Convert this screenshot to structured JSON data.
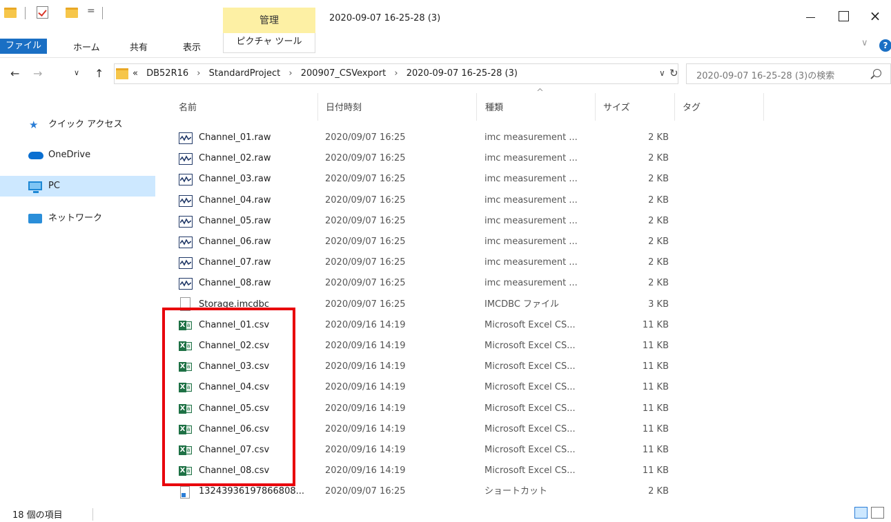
{
  "window": {
    "title": "2020-09-07 16-25-28 (3)",
    "manage_tab": "管理"
  },
  "quick_access_toolbar": {
    "dropdown": "="
  },
  "window_controls": {
    "close": "×"
  },
  "ribbon": {
    "tabs": [
      "ファイル",
      "ホーム",
      "共有",
      "表示",
      "ピクチャ ツール"
    ],
    "expand": "∨",
    "help": "?"
  },
  "navigation": {
    "back": "←",
    "forward": "→",
    "recent": "∨",
    "up": "↑",
    "overflow": "«",
    "breadcrumbs": [
      "DB52R16",
      "StandardProject",
      "200907_CSVexport",
      "2020-09-07 16-25-28 (3)"
    ],
    "separator": "›",
    "dropdown": "∨",
    "refresh": "↻"
  },
  "search": {
    "placeholder": "2020-09-07 16-25-28 (3)の検索"
  },
  "sidebar": {
    "items": [
      {
        "label": "クイック アクセス",
        "icon": "star-icon"
      },
      {
        "label": "OneDrive",
        "icon": "cloud-icon"
      },
      {
        "label": "PC",
        "icon": "computer-icon"
      },
      {
        "label": "ネットワーク",
        "icon": "network-icon"
      }
    ]
  },
  "columns": {
    "name": "名前",
    "date": "日付時刻",
    "type": "種類",
    "size": "サイズ",
    "tag": "タグ",
    "sort_indicator": "^"
  },
  "files": [
    {
      "name": "Channel_01.raw",
      "date": "2020/09/07 16:25",
      "type": "imc measurement ...",
      "size": "2 KB",
      "icon": "raw"
    },
    {
      "name": "Channel_02.raw",
      "date": "2020/09/07 16:25",
      "type": "imc measurement ...",
      "size": "2 KB",
      "icon": "raw"
    },
    {
      "name": "Channel_03.raw",
      "date": "2020/09/07 16:25",
      "type": "imc measurement ...",
      "size": "2 KB",
      "icon": "raw"
    },
    {
      "name": "Channel_04.raw",
      "date": "2020/09/07 16:25",
      "type": "imc measurement ...",
      "size": "2 KB",
      "icon": "raw"
    },
    {
      "name": "Channel_05.raw",
      "date": "2020/09/07 16:25",
      "type": "imc measurement ...",
      "size": "2 KB",
      "icon": "raw"
    },
    {
      "name": "Channel_06.raw",
      "date": "2020/09/07 16:25",
      "type": "imc measurement ...",
      "size": "2 KB",
      "icon": "raw"
    },
    {
      "name": "Channel_07.raw",
      "date": "2020/09/07 16:25",
      "type": "imc measurement ...",
      "size": "2 KB",
      "icon": "raw"
    },
    {
      "name": "Channel_08.raw",
      "date": "2020/09/07 16:25",
      "type": "imc measurement ...",
      "size": "2 KB",
      "icon": "raw"
    },
    {
      "name": "Storage.imcdbc",
      "date": "2020/09/07 16:25",
      "type": "IMCDBC ファイル",
      "size": "3 KB",
      "icon": "doc"
    },
    {
      "name": "Channel_01.csv",
      "date": "2020/09/16 14:19",
      "type": "Microsoft Excel CS...",
      "size": "11 KB",
      "icon": "xls"
    },
    {
      "name": "Channel_02.csv",
      "date": "2020/09/16 14:19",
      "type": "Microsoft Excel CS...",
      "size": "11 KB",
      "icon": "xls"
    },
    {
      "name": "Channel_03.csv",
      "date": "2020/09/16 14:19",
      "type": "Microsoft Excel CS...",
      "size": "11 KB",
      "icon": "xls"
    },
    {
      "name": "Channel_04.csv",
      "date": "2020/09/16 14:19",
      "type": "Microsoft Excel CS...",
      "size": "11 KB",
      "icon": "xls"
    },
    {
      "name": "Channel_05.csv",
      "date": "2020/09/16 14:19",
      "type": "Microsoft Excel CS...",
      "size": "11 KB",
      "icon": "xls"
    },
    {
      "name": "Channel_06.csv",
      "date": "2020/09/16 14:19",
      "type": "Microsoft Excel CS...",
      "size": "11 KB",
      "icon": "xls"
    },
    {
      "name": "Channel_07.csv",
      "date": "2020/09/16 14:19",
      "type": "Microsoft Excel CS...",
      "size": "11 KB",
      "icon": "xls"
    },
    {
      "name": "Channel_08.csv",
      "date": "2020/09/16 14:19",
      "type": "Microsoft Excel CS...",
      "size": "11 KB",
      "icon": "xls"
    },
    {
      "name": "13243936197866808...",
      "date": "2020/09/07 16:25",
      "type": "ショートカット",
      "size": "2 KB",
      "icon": "lnk"
    }
  ],
  "status_bar": {
    "item_count": "18 個の項目"
  },
  "colors": {
    "accent": "#1a6fc4",
    "manage_tab": "#fdf0a4",
    "selection": "#cde8ff",
    "highlight_box": "#e8000b",
    "excel_green": "#1e7145"
  }
}
